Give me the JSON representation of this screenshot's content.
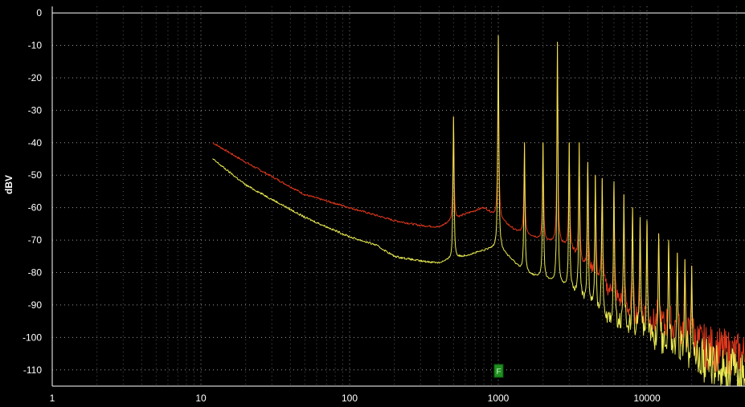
{
  "chart_data": {
    "type": "line",
    "title": "",
    "xlabel": "",
    "ylabel": "dBV",
    "xscale": "log",
    "xlim": [
      1,
      48000
    ],
    "ylim": [
      -115,
      2
    ],
    "grid": true,
    "legend": "none",
    "x_ticks": [
      "1",
      "10",
      "100",
      "1000",
      "10000"
    ],
    "y_ticks": [
      "0",
      "-10",
      "-20",
      "-30",
      "-40",
      "-50",
      "-60",
      "-70",
      "-80",
      "-90",
      "-100",
      "-110"
    ],
    "colors": {
      "background": "#000000",
      "grid": "#9a9a9a",
      "axis": "#ffffff",
      "series_red": "#e0381c",
      "series_yellow": "#e9ea52",
      "marker": "#1f8f1f"
    },
    "marker": {
      "x": 1000,
      "symbol": "F"
    },
    "series": [
      {
        "color": "#e0381c",
        "noise_floor": [
          [
            12,
            -40
          ],
          [
            20,
            -46
          ],
          [
            50,
            -56
          ],
          [
            100,
            -60
          ],
          [
            200,
            -64
          ],
          [
            300,
            -65.5
          ],
          [
            400,
            -66
          ],
          [
            600,
            -62
          ],
          [
            800,
            -60
          ],
          [
            1300,
            -67
          ],
          [
            2000,
            -70
          ],
          [
            3000,
            -72
          ],
          [
            4000,
            -79
          ],
          [
            8000,
            -94
          ],
          [
            15000,
            -98
          ],
          [
            25000,
            -103
          ],
          [
            48000,
            -106
          ]
        ],
        "peaks": [
          [
            500,
            -32
          ],
          [
            1000,
            -7
          ],
          [
            1500,
            -40
          ],
          [
            2000,
            -40
          ],
          [
            2500,
            -9
          ],
          [
            3000,
            -40
          ],
          [
            3500,
            -40
          ],
          [
            4000,
            -46
          ],
          [
            4500,
            -50
          ],
          [
            5000,
            -51
          ],
          [
            6000,
            -52
          ],
          [
            7000,
            -56
          ],
          [
            8000,
            -60
          ],
          [
            9000,
            -63
          ],
          [
            10000,
            -64
          ],
          [
            12000,
            -68
          ],
          [
            14000,
            -70
          ],
          [
            16000,
            -74
          ],
          [
            18000,
            -76
          ],
          [
            20000,
            -78
          ]
        ]
      },
      {
        "color": "#e9ea52",
        "noise_floor": [
          [
            12,
            -45
          ],
          [
            20,
            -53
          ],
          [
            50,
            -63
          ],
          [
            100,
            -69
          ],
          [
            150,
            -71.5
          ],
          [
            200,
            -75
          ],
          [
            300,
            -76.5
          ],
          [
            400,
            -77
          ],
          [
            700,
            -74
          ],
          [
            1000,
            -72
          ],
          [
            1500,
            -80
          ],
          [
            2000,
            -82
          ],
          [
            3000,
            -85
          ],
          [
            4000,
            -90
          ],
          [
            6000,
            -96
          ],
          [
            10000,
            -100
          ],
          [
            20000,
            -106
          ],
          [
            48000,
            -112
          ]
        ],
        "peaks": [
          [
            500,
            -32
          ],
          [
            1000,
            -7
          ],
          [
            1500,
            -40
          ],
          [
            2000,
            -40
          ],
          [
            2500,
            -9
          ],
          [
            3000,
            -40
          ],
          [
            3500,
            -40
          ],
          [
            4000,
            -46
          ],
          [
            4500,
            -50
          ],
          [
            5000,
            -51
          ],
          [
            6000,
            -52
          ],
          [
            7000,
            -56
          ],
          [
            8000,
            -60
          ],
          [
            9000,
            -63
          ],
          [
            10000,
            -64
          ],
          [
            12000,
            -68
          ],
          [
            14000,
            -70
          ],
          [
            16000,
            -74
          ],
          [
            18000,
            -76
          ],
          [
            20000,
            -78
          ]
        ]
      }
    ]
  }
}
